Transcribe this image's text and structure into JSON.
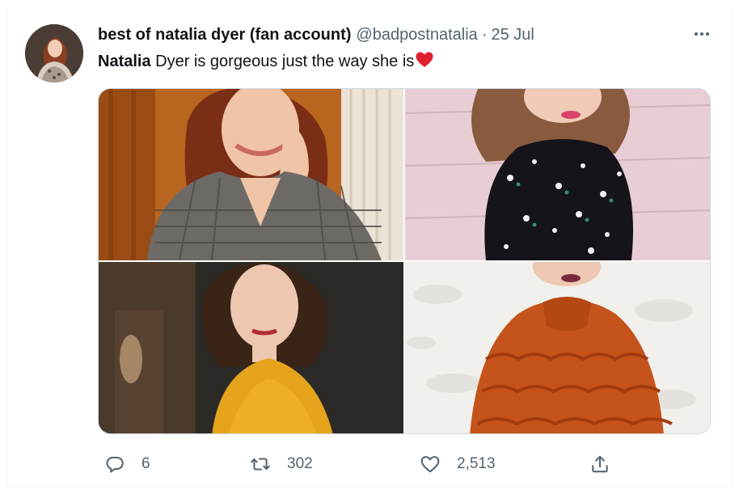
{
  "tweet": {
    "author": {
      "display_name": "best of natalia dyer (fan account)",
      "handle": "@badpostnatalia",
      "separator": "·",
      "date": "25 Jul"
    },
    "text": {
      "bold_part": "Natalia",
      "rest": " Dyer is gorgeous just the way she is",
      "emoji": "heart-emoji"
    },
    "media": {
      "count": 4,
      "photos": [
        "photo-plaid-blazer",
        "photo-floral-blouse",
        "photo-yellow-sweater",
        "photo-orange-ruffle-blouse"
      ]
    },
    "actions": {
      "reply_count": "6",
      "retweet_count": "302",
      "like_count": "2,513"
    }
  },
  "icons": {
    "more": "more-dots-icon",
    "reply": "reply-bubble-icon",
    "retweet": "retweet-arrows-icon",
    "like": "heart-outline-icon",
    "share": "share-upload-icon"
  },
  "colors": {
    "text_primary": "#0f1419",
    "text_secondary": "#536471",
    "border": "#cfd9de",
    "emoji_heart": "#e0202f"
  }
}
